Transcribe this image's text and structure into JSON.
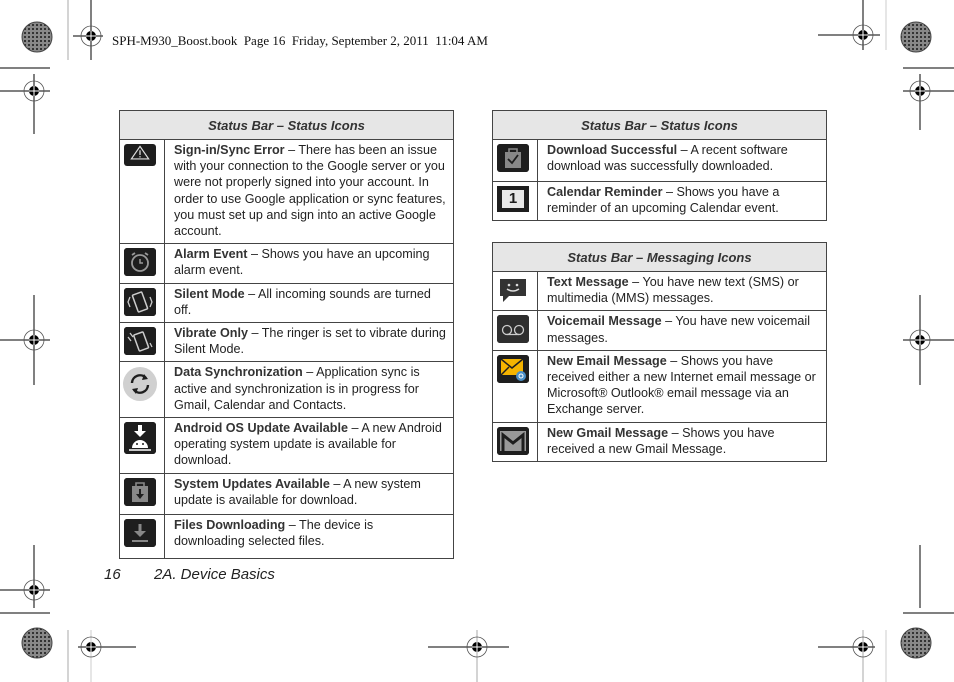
{
  "print_header": "SPH-M930_Boost.book  Page 16  Friday, September 2, 2011  11:04 AM",
  "footer": {
    "page_number": "16",
    "section": "2A. Device Basics"
  },
  "left_table": {
    "title": "Status Bar – Status Icons",
    "rows": [
      {
        "icon": "warning-triangle-icon",
        "term": "Sign-in/Sync Error",
        "desc": " – There has been an issue with your connection to the Google server or you were not properly signed into your account. In order to use Google application or sync features, you must set up and sign into an active Google account."
      },
      {
        "icon": "alarm-clock-icon",
        "term": "Alarm Event",
        "desc": " – Shows you have an upcoming alarm event."
      },
      {
        "icon": "silent-mode-icon",
        "term": "Silent Mode",
        "desc": " – All incoming sounds are turned off."
      },
      {
        "icon": "vibrate-icon",
        "term": "Vibrate Only",
        "desc": " – The ringer is set to vibrate during Silent Mode."
      },
      {
        "icon": "sync-icon",
        "term": "Data Synchronization",
        "desc": " – Application sync is active and synchronization is in progress for Gmail, Calendar and Contacts."
      },
      {
        "icon": "android-update-icon",
        "term": "Android OS Update Available",
        "desc": " – A new Android operating system update is available for download."
      },
      {
        "icon": "system-update-icon",
        "term": "System Updates Available",
        "desc": " – A new system update is available for download."
      },
      {
        "icon": "download-icon",
        "term": "Files Downloading",
        "desc": " – The device is downloading selected files."
      }
    ]
  },
  "right_status_table": {
    "title": "Status Bar – Status Icons",
    "rows": [
      {
        "icon": "download-successful-icon",
        "term": "Download Successful",
        "desc": " – A recent software download was successfully downloaded."
      },
      {
        "icon": "calendar-icon",
        "term": "Calendar Reminder",
        "desc": " – Shows you have a reminder of an upcoming Calendar event.",
        "glyph": "1"
      }
    ]
  },
  "right_messaging_table": {
    "title": "Status Bar – Messaging Icons",
    "rows": [
      {
        "icon": "text-message-icon",
        "term": "Text Message",
        "desc": " – You have new text (SMS) or multimedia (MMS) messages."
      },
      {
        "icon": "voicemail-icon",
        "term": "Voicemail Message",
        "desc": " – You have new voicemail messages."
      },
      {
        "icon": "email-icon",
        "term": "New Email Message",
        "desc": " – Shows you have received either a new Internet email message or Microsoft® Outlook® email message via an Exchange server."
      },
      {
        "icon": "gmail-icon",
        "term": "New Gmail Message",
        "desc": " – Shows you have received a new Gmail Message."
      }
    ]
  },
  "colors": {
    "header_bg": "#e6e6e6",
    "border": "#444444",
    "icon_bg": "#1e1e1e",
    "email_accent": "#f5b400"
  }
}
